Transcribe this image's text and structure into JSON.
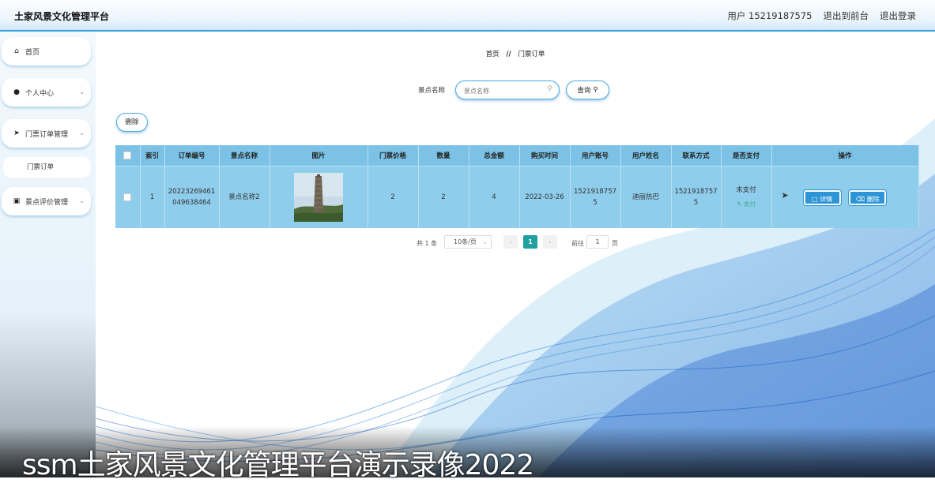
{
  "header": {
    "title": "土家风景文化管理平台",
    "user_label": "用户 15219187575",
    "back_link": "退出到前台",
    "logout_link": "退出登录"
  },
  "sidebar": {
    "items": [
      {
        "label": "首页",
        "icon": "home-icon"
      },
      {
        "label": "个人中心",
        "icon": "user-icon"
      },
      {
        "label": "门票订单管理",
        "icon": "paper-plane-icon"
      },
      {
        "label": "景点评价管理",
        "icon": "checkbox-icon"
      }
    ],
    "sub_items": [
      {
        "label": "门票订单"
      }
    ]
  },
  "breadcrumb": {
    "home": "首页",
    "separator": "//",
    "current": "门票订单"
  },
  "search": {
    "label": "景点名称",
    "placeholder": "景点名称",
    "query_label": "查询"
  },
  "toolbar": {
    "delete_label": "删除"
  },
  "table": {
    "columns": [
      "索引",
      "订单编号",
      "景点名称",
      "图片",
      "门票价格",
      "数量",
      "总金额",
      "购买时间",
      "用户账号",
      "用户姓名",
      "联系方式",
      "是否支付",
      "操作"
    ],
    "rows": [
      {
        "index": "1",
        "order_no": "20223269461049638464",
        "spot_name": "景点名称2",
        "price": "2",
        "quantity": "2",
        "total": "4",
        "purchase_time": "2022-03-26",
        "account": "15219187575",
        "user_name": "迪丽热巴",
        "contact": "15219187575",
        "pay_status": "未支付",
        "pay_link": "支付",
        "detail_label": "详情",
        "delete_label": "删除"
      }
    ]
  },
  "pagination": {
    "total": "共 1 条",
    "page_size": "10条/页",
    "current_page": "1",
    "goto_label": "前往",
    "goto_value": "1",
    "page_unit": "页"
  },
  "caption": "ssm土家风景文化管理平台演示录像2022",
  "colors": {
    "accent": "#3aa0e0",
    "table_header": "#7bc2e6",
    "table_row": "#8fcdec",
    "button": "#2d95d6",
    "page_active": "#20a0a0",
    "pay_link": "#2fae88"
  }
}
